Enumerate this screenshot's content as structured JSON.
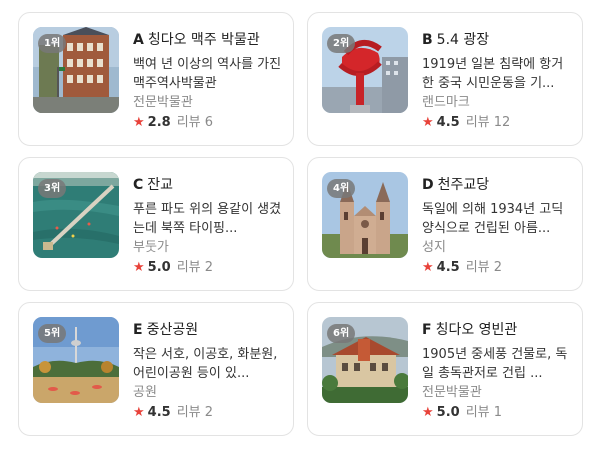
{
  "colors": {
    "star": "#e8423a",
    "border": "#e3e3e3",
    "rank_badge": "#787878"
  },
  "places": [
    {
      "rank": "1위",
      "letter": "A",
      "name": "칭다오 맥주 박물관",
      "desc": "백여 년 이상의 역사를 가진 맥주역사박물관",
      "category": "전문박물관",
      "star": "★",
      "score": "2.8",
      "reviews": "리뷰 6"
    },
    {
      "rank": "2위",
      "letter": "B",
      "name": "5.4 광장",
      "desc": "1919년 일본 침략에 항거한 중국 시민운동을 기...",
      "category": "랜드마크",
      "star": "★",
      "score": "4.5",
      "reviews": "리뷰 12"
    },
    {
      "rank": "3위",
      "letter": "C",
      "name": "잔교",
      "desc": "푸른 파도 위의 용같이 생겼는데 북쪽 타이핑...",
      "category": "부둣가",
      "star": "★",
      "score": "5.0",
      "reviews": "리뷰 2"
    },
    {
      "rank": "4위",
      "letter": "D",
      "name": "천주교당",
      "desc": "독일에 의해 1934년 고딕양식으로 건립된 아름...",
      "category": "성지",
      "star": "★",
      "score": "4.5",
      "reviews": "리뷰 2"
    },
    {
      "rank": "5위",
      "letter": "E",
      "name": "중산공원",
      "desc": "작은 서호, 이공호, 화분원, 어린이공원 등이 있...",
      "category": "공원",
      "star": "★",
      "score": "4.5",
      "reviews": "리뷰 2"
    },
    {
      "rank": "6위",
      "letter": "F",
      "name": "칭다오 영빈관",
      "desc": "1905년 중세풍 건물로, 독일 총독관저로 건립 ...",
      "category": "전문박물관",
      "star": "★",
      "score": "5.0",
      "reviews": "리뷰 1"
    }
  ]
}
